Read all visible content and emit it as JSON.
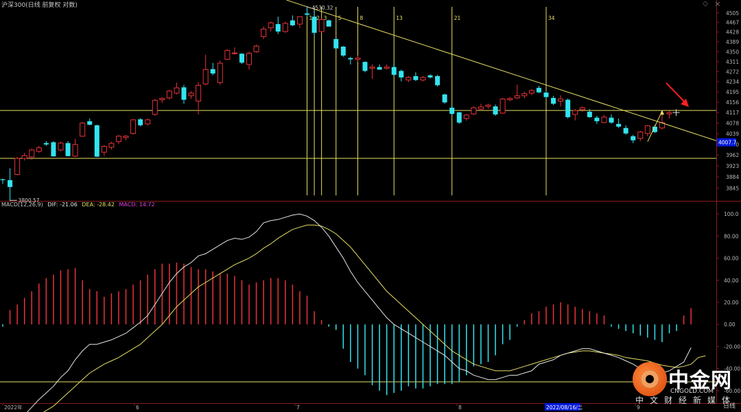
{
  "header": {
    "title": "沪深300(日线 前复权 对数)",
    "high_label": "4530.32",
    "low_label": "3800.57",
    "minimize_icon": "diamond-icon",
    "close_icon": "close-icon"
  },
  "price_axis": {
    "ticks": [
      "4505",
      "4467",
      "4428",
      "4389",
      "4350",
      "4311",
      "4272",
      "4234",
      "4195",
      "4156",
      "4117",
      "4078",
      "4039",
      "4000",
      "3962",
      "3923",
      "3884",
      "3845"
    ],
    "current_label": "4007.7"
  },
  "macd": {
    "legend": "MACD(12,26,9)",
    "dif_label": "DIF: -21.06",
    "dea_label": "DEA: -28.42",
    "macd_label": "MACD: 14.72",
    "ticks": [
      "100.0",
      "80.00",
      "60.00",
      "40.00",
      "20.00",
      "0.00",
      "-20.00",
      "-40.00",
      "-60.00"
    ]
  },
  "time_axis": {
    "labels": [
      "2022年",
      "6",
      "7",
      "8",
      "9"
    ],
    "cursor_date": "2022/08/16/二",
    "period_button": "日线"
  },
  "fib_labels": [
    "1",
    "2",
    "3",
    "5",
    "8",
    "13",
    "21",
    "34"
  ],
  "logo": {
    "name": "中金网",
    "domain": "CNGOLD.COM",
    "slogan": "中文财经新媒体"
  },
  "colors": {
    "up": "#e8333a",
    "down": "#33e4f0",
    "line": "#e8e064",
    "dif": "#e6e6e6",
    "dea": "#e8e064",
    "axis": "#8a1c1c",
    "current_bg": "#0018d8"
  },
  "chart_data": [
    {
      "type": "candlestick",
      "title": "沪深300(日线 前复权 对数)",
      "ylim": [
        3820,
        4530
      ],
      "candles": [
        [
          3876,
          3878,
          3860,
          3873
        ],
        [
          3873,
          3915,
          3800.57,
          3849
        ],
        [
          3893,
          3955,
          3890,
          3950
        ],
        [
          3950,
          3970,
          3942,
          3960
        ],
        [
          3955,
          3985,
          3945,
          3980
        ],
        [
          3975,
          3995,
          3970,
          3988
        ],
        [
          4005,
          4012,
          3995,
          4000
        ],
        [
          4008,
          4012,
          3958,
          3957
        ],
        [
          3980,
          4010,
          3975,
          4005
        ],
        [
          4005,
          4012,
          3960,
          3958
        ],
        [
          3958,
          4020,
          3955,
          4000
        ],
        [
          4030,
          4082,
          4028,
          4078
        ],
        [
          4085,
          4095,
          4070,
          4072
        ],
        [
          4070,
          4072,
          3955,
          3956
        ],
        [
          3972,
          3998,
          3960,
          3993
        ],
        [
          3990,
          4010,
          3982,
          4004
        ],
        [
          4010,
          4035,
          4002,
          4030
        ],
        [
          4025,
          4034,
          4015,
          4030
        ],
        [
          4040,
          4092,
          4036,
          4090
        ],
        [
          4092,
          4096,
          4066,
          4070
        ],
        [
          4075,
          4095,
          4068,
          4090
        ],
        [
          4110,
          4168,
          4105,
          4163
        ],
        [
          4165,
          4175,
          4153,
          4170
        ],
        [
          4172,
          4202,
          4166,
          4198
        ],
        [
          4190,
          4230,
          4185,
          4210
        ],
        [
          4212,
          4222,
          4150,
          4165
        ],
        [
          4180,
          4198,
          4168,
          4190
        ],
        [
          4160,
          4232,
          4110,
          4220
        ],
        [
          4225,
          4338,
          4220,
          4280
        ],
        [
          4282,
          4306,
          4258,
          4265
        ],
        [
          4230,
          4315,
          4222,
          4305
        ],
        [
          4320,
          4360,
          4318,
          4355
        ],
        [
          4343,
          4367,
          4338,
          4345
        ],
        [
          4342,
          4344,
          4302,
          4307
        ],
        [
          4300,
          4350,
          4280,
          4344
        ],
        [
          4350,
          4378,
          4345,
          4372
        ],
        [
          4410,
          4450,
          4400,
          4440
        ],
        [
          4445,
          4470,
          4430,
          4465
        ],
        [
          4460,
          4490,
          4420,
          4430
        ],
        [
          4430,
          4470,
          4425,
          4463
        ],
        [
          4475,
          4495,
          4452,
          4455
        ],
        [
          4460,
          4490,
          4445,
          4490
        ],
        [
          4503,
          4530.32,
          4490,
          4498
        ],
        [
          4490,
          4515,
          4410,
          4425
        ],
        [
          4430,
          4485,
          4425,
          4478
        ],
        [
          4475,
          4478,
          4455,
          4450
        ],
        [
          4400,
          4405,
          4362,
          4363
        ],
        [
          4370,
          4372,
          4330,
          4335
        ],
        [
          4325,
          4330,
          4300,
          4320
        ],
        [
          4320,
          4335,
          4310,
          4325
        ],
        [
          4310,
          4312,
          4270,
          4275
        ],
        [
          4285,
          4300,
          4245,
          4290
        ],
        [
          4290,
          4300,
          4280,
          4280
        ],
        [
          4285,
          4300,
          4280,
          4290
        ],
        [
          4290,
          4305,
          4255,
          4260
        ],
        [
          4275,
          4280,
          4235,
          4250
        ],
        [
          4240,
          4255,
          4232,
          4250
        ],
        [
          4255,
          4270,
          4236,
          4240
        ],
        [
          4240,
          4255,
          4235,
          4250
        ],
        [
          4258,
          4262,
          4246,
          4250
        ],
        [
          4255,
          4260,
          4215,
          4220
        ],
        [
          4185,
          4188,
          4150,
          4155
        ],
        [
          4135,
          4140,
          4110,
          4112
        ],
        [
          4118,
          4120,
          4075,
          4080
        ],
        [
          4095,
          4112,
          4087,
          4108
        ],
        [
          4112,
          4140,
          4108,
          4135
        ],
        [
          4130,
          4150,
          4128,
          4138
        ],
        [
          4140,
          4150,
          4132,
          4145
        ],
        [
          4140,
          4147,
          4105,
          4110
        ],
        [
          4115,
          4172,
          4112,
          4168
        ],
        [
          4165,
          4175,
          4160,
          4170
        ],
        [
          4172,
          4222,
          4168,
          4180
        ],
        [
          4180,
          4195,
          4170,
          4188
        ],
        [
          4190,
          4205,
          4182,
          4200
        ],
        [
          4210,
          4218,
          4190,
          4193
        ],
        [
          4192,
          4200,
          4168,
          4175
        ],
        [
          4172,
          4180,
          4145,
          4150
        ],
        [
          4160,
          4182,
          4140,
          4168
        ],
        [
          4165,
          4170,
          4095,
          4100
        ],
        [
          4110,
          4130,
          4088,
          4125
        ],
        [
          4128,
          4140,
          4120,
          4135
        ],
        [
          4120,
          4130,
          4098,
          4100
        ],
        [
          4098,
          4105,
          4075,
          4085
        ],
        [
          4080,
          4108,
          4078,
          4100
        ],
        [
          4098,
          4110,
          4075,
          4080
        ],
        [
          4075,
          4095,
          4060,
          4065
        ],
        [
          4060,
          4070,
          4035,
          4040
        ],
        [
          4030,
          4035,
          4005,
          4015
        ],
        [
          4022,
          4050,
          4012,
          4045
        ],
        [
          4040,
          4070,
          4030,
          4068
        ],
        [
          4065,
          4072,
          4042,
          4045
        ],
        [
          4060,
          4118,
          4055,
          4080
        ],
        [
          4112,
          4128,
          4095,
          4117
        ]
      ],
      "horizontal_lines": [
        4125,
        3950
      ],
      "trendline": {
        "from": {
          "bar": 42,
          "price": 4530.32
        },
        "to": {
          "bar": 96,
          "price": 4035
        }
      },
      "fibonacci_time_zones": [
        42,
        43,
        44,
        46,
        49,
        54,
        62,
        75
      ],
      "extrema": {
        "high": 4530.32,
        "low": 3800.57
      },
      "current_price": 4007.7
    },
    {
      "type": "bar+line",
      "title": "MACD(12,26,9)",
      "ylim": [
        -70,
        110
      ],
      "macd": [
        -2,
        13,
        18,
        24,
        30,
        37,
        42,
        45,
        49,
        50,
        51,
        40,
        32,
        30,
        25,
        28,
        30,
        32,
        36,
        40,
        45,
        50,
        55,
        55,
        56,
        55,
        52,
        50,
        50,
        48,
        46,
        46,
        44,
        40,
        36,
        38,
        40,
        42,
        42,
        40,
        36,
        30,
        26,
        12,
        4,
        -2,
        -5,
        -22,
        -34,
        -40,
        -46,
        -55,
        -60,
        -64,
        -62,
        -60,
        -56,
        -58,
        -58,
        -56,
        -54,
        -54,
        -54,
        -52,
        -46,
        -38,
        -36,
        -34,
        -28,
        -18,
        -14,
        -2,
        4,
        10,
        12,
        16,
        18,
        20,
        18,
        16,
        14,
        12,
        10,
        8,
        -2,
        -4,
        -6,
        -8,
        -10,
        -12,
        -14,
        -16,
        -8,
        -6,
        8,
        14.72
      ],
      "dif": [
        -95,
        -92,
        -88,
        -82,
        -75,
        -68,
        -62,
        -56,
        -48,
        -42,
        -32,
        -24,
        -18,
        -18,
        -16,
        -14,
        -11,
        -8,
        -3,
        2,
        8,
        18,
        28,
        38,
        46,
        52,
        56,
        62,
        64,
        68,
        72,
        76,
        78,
        77,
        79,
        84,
        92,
        94,
        95,
        97,
        99,
        100,
        98,
        94,
        88,
        80,
        70,
        60,
        48,
        38,
        30,
        22,
        14,
        6,
        0,
        -4,
        -8,
        -12,
        -16,
        -20,
        -24,
        -28,
        -34,
        -40,
        -42,
        -46,
        -48,
        -50,
        -50,
        -48,
        -46,
        -46,
        -44,
        -42,
        -36,
        -34,
        -32,
        -28,
        -26,
        -24,
        -22,
        -22,
        -24,
        -26,
        -28,
        -30,
        -33,
        -36,
        -40,
        -42,
        -44,
        -44,
        -42,
        -38,
        -34,
        -21.06
      ],
      "dea": [
        -95,
        -94,
        -92,
        -90,
        -86,
        -82,
        -78,
        -74,
        -68,
        -62,
        -56,
        -50,
        -44,
        -40,
        -36,
        -33,
        -30,
        -26,
        -22,
        -18,
        -12,
        -6,
        0,
        8,
        16,
        22,
        28,
        34,
        38,
        42,
        46,
        50,
        54,
        57,
        60,
        64,
        69,
        73,
        78,
        82,
        86,
        88,
        90,
        90,
        89,
        86,
        82,
        76,
        70,
        62,
        54,
        46,
        38,
        30,
        24,
        18,
        12,
        6,
        0,
        -6,
        -12,
        -18,
        -24,
        -28,
        -32,
        -36,
        -38,
        -40,
        -42,
        -42,
        -42,
        -40,
        -38,
        -36,
        -34,
        -32,
        -30,
        -28,
        -26,
        -25,
        -24,
        -24,
        -25,
        -26,
        -27,
        -28,
        -30,
        -31,
        -32,
        -33,
        -35,
        -37,
        -38,
        -39,
        -38,
        -36,
        -30,
        -28.42
      ]
    }
  ]
}
